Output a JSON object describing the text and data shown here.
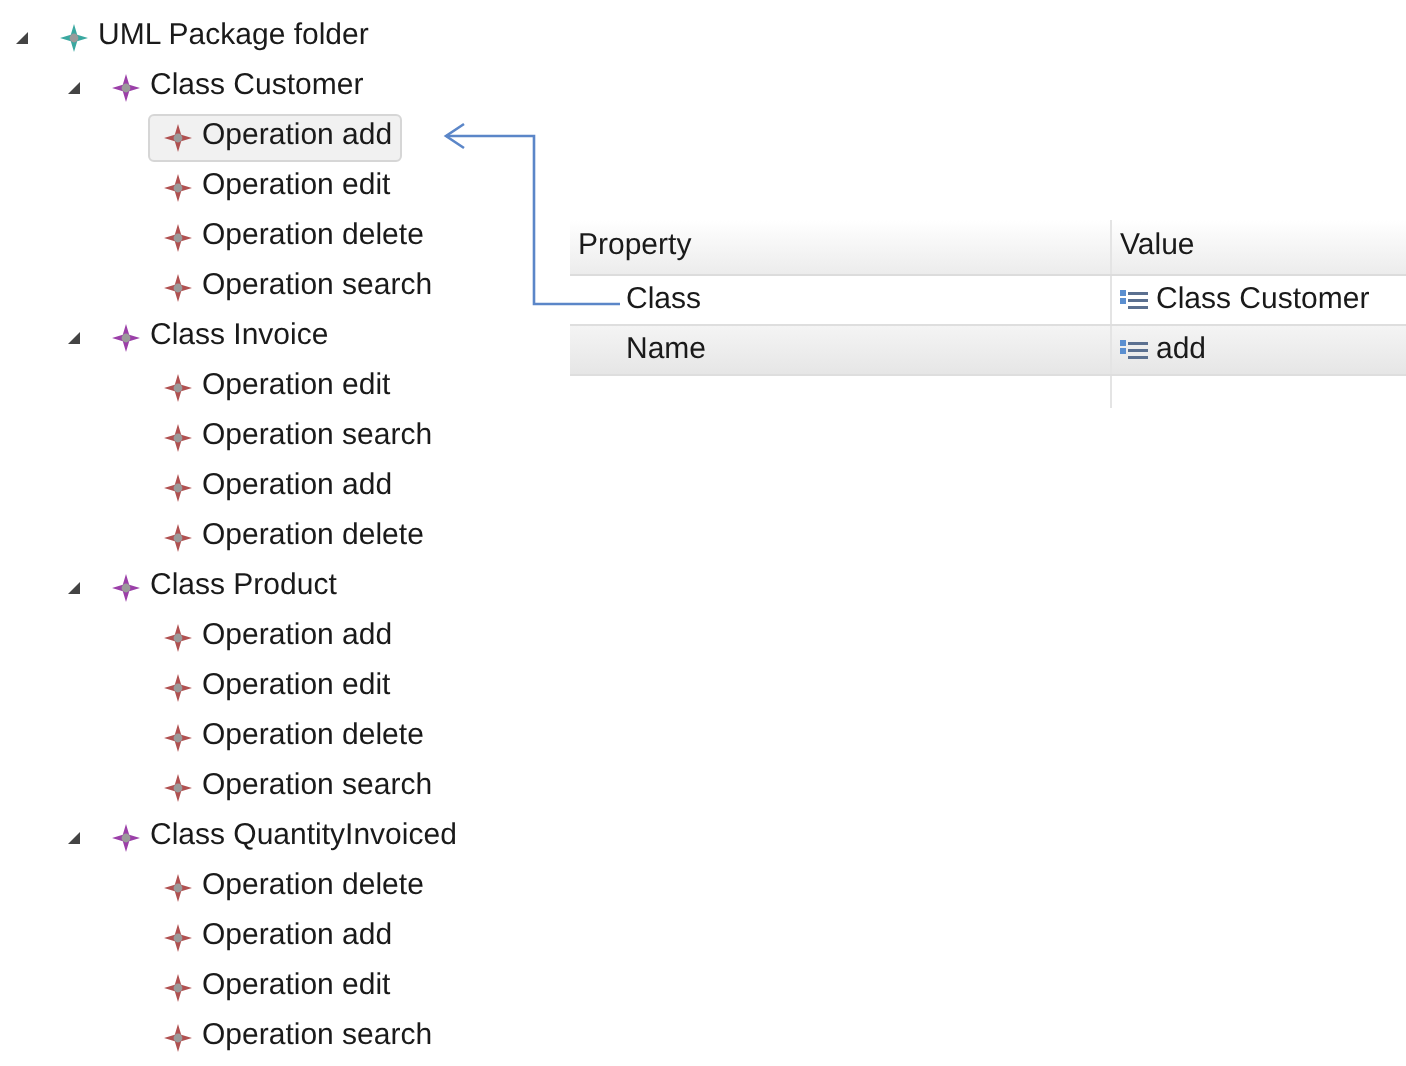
{
  "tree": {
    "label": "UML Package folder",
    "kind": "package",
    "expanded": true,
    "selected": false,
    "children": [
      {
        "label": "Class Customer",
        "kind": "class",
        "expanded": true,
        "selected": false,
        "children": [
          {
            "label": "Operation add",
            "kind": "operation",
            "selected": true
          },
          {
            "label": "Operation edit",
            "kind": "operation",
            "selected": false
          },
          {
            "label": "Operation delete",
            "kind": "operation",
            "selected": false
          },
          {
            "label": "Operation search",
            "kind": "operation",
            "selected": false
          }
        ]
      },
      {
        "label": "Class Invoice",
        "kind": "class",
        "expanded": true,
        "selected": false,
        "children": [
          {
            "label": "Operation edit",
            "kind": "operation",
            "selected": false
          },
          {
            "label": "Operation search",
            "kind": "operation",
            "selected": false
          },
          {
            "label": "Operation add",
            "kind": "operation",
            "selected": false
          },
          {
            "label": "Operation delete",
            "kind": "operation",
            "selected": false
          }
        ]
      },
      {
        "label": "Class Product",
        "kind": "class",
        "expanded": true,
        "selected": false,
        "children": [
          {
            "label": "Operation add",
            "kind": "operation",
            "selected": false
          },
          {
            "label": "Operation edit",
            "kind": "operation",
            "selected": false
          },
          {
            "label": "Operation delete",
            "kind": "operation",
            "selected": false
          },
          {
            "label": "Operation search",
            "kind": "operation",
            "selected": false
          }
        ]
      },
      {
        "label": "Class QuantityInvoiced",
        "kind": "class",
        "expanded": true,
        "selected": false,
        "children": [
          {
            "label": "Operation delete",
            "kind": "operation",
            "selected": false
          },
          {
            "label": "Operation add",
            "kind": "operation",
            "selected": false
          },
          {
            "label": "Operation edit",
            "kind": "operation",
            "selected": false
          },
          {
            "label": "Operation search",
            "kind": "operation",
            "selected": false
          }
        ]
      }
    ]
  },
  "properties": {
    "columns": [
      "Property",
      "Value"
    ],
    "rows": [
      {
        "property": "Class",
        "value": "Class Customer"
      },
      {
        "property": "Name",
        "value": "add"
      }
    ]
  }
}
